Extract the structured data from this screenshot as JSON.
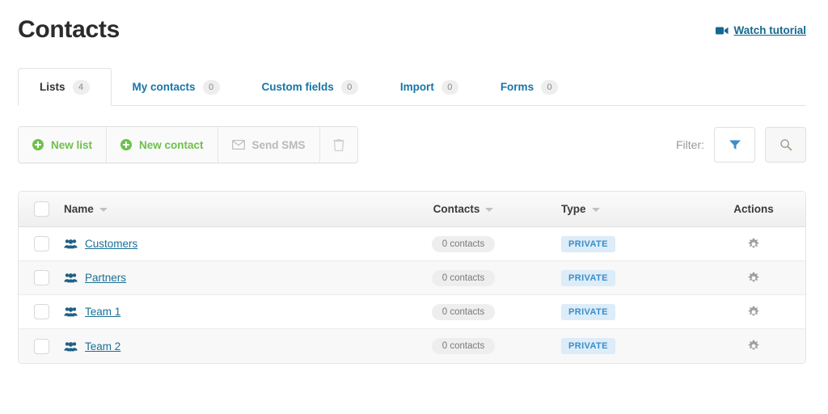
{
  "header": {
    "title": "Contacts",
    "watch_tutorial": {
      "label": "Watch tutorial",
      "icon": "video-camera-icon",
      "color": "#15688f"
    }
  },
  "tabs": [
    {
      "label": "Lists",
      "count": "4",
      "active": true
    },
    {
      "label": "My contacts",
      "count": "0",
      "active": false
    },
    {
      "label": "Custom fields",
      "count": "0",
      "active": false
    },
    {
      "label": "Import",
      "count": "0",
      "active": false
    },
    {
      "label": "Forms",
      "count": "0",
      "active": false
    }
  ],
  "toolbar": {
    "buttons": [
      {
        "label": "New list",
        "icon": "plus-circle-icon",
        "state": "enabled"
      },
      {
        "label": "New contact",
        "icon": "plus-circle-icon",
        "state": "enabled"
      },
      {
        "label": "Send SMS",
        "icon": "envelope-icon",
        "state": "disabled"
      },
      {
        "label": "",
        "icon": "trash-icon",
        "state": "disabled"
      }
    ],
    "filter_label": "Filter:",
    "filter_button_icon": "funnel-icon",
    "search_button_icon": "search-icon"
  },
  "table": {
    "columns": [
      {
        "label": "",
        "key": "select",
        "sortable": false
      },
      {
        "label": "Name",
        "key": "name",
        "sortable": true
      },
      {
        "label": "Contacts",
        "key": "contacts",
        "sortable": true
      },
      {
        "label": "Type",
        "key": "type",
        "sortable": true
      },
      {
        "label": "Actions",
        "key": "actions",
        "sortable": false
      }
    ],
    "rows": [
      {
        "name": "Customers",
        "icon": "group-icon",
        "contacts": "0 contacts",
        "type": "PRIVATE",
        "action_icon": "gear-icon"
      },
      {
        "name": "Partners",
        "icon": "group-icon",
        "contacts": "0 contacts",
        "type": "PRIVATE",
        "action_icon": "gear-icon"
      },
      {
        "name": "Team 1",
        "icon": "group-icon",
        "contacts": "0 contacts",
        "type": "PRIVATE",
        "action_icon": "gear-icon"
      },
      {
        "name": "Team 2",
        "icon": "group-icon",
        "contacts": "0 contacts",
        "type": "PRIVATE",
        "action_icon": "gear-icon"
      }
    ]
  },
  "colors": {
    "accent_green": "#6ec04b",
    "link_blue": "#1b6f97",
    "tab_blue": "#1676a8",
    "badge_bg": "#dcecf8",
    "badge_text": "#3a8dc8",
    "row_alt_bg": "#f8f8f8"
  }
}
